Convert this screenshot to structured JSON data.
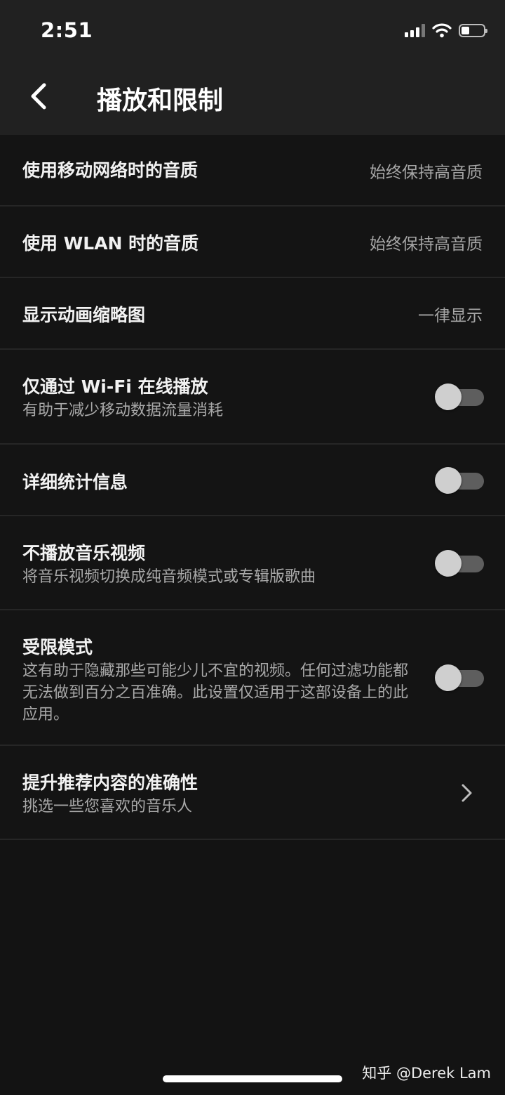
{
  "status_bar": {
    "time": "2:51"
  },
  "header": {
    "title": "播放和限制"
  },
  "settings": [
    {
      "title": "使用移动网络时的音质",
      "value": "始终保持高音质"
    },
    {
      "title": "使用 WLAN 时的音质",
      "value": "始终保持高音质"
    },
    {
      "title": "显示动画缩略图",
      "value": "一律显示"
    },
    {
      "title": "仅通过 Wi-Fi 在线播放",
      "subtitle": "有助于减少移动数据流量消耗",
      "toggle": false
    },
    {
      "title": "详细统计信息",
      "toggle": false
    },
    {
      "title": "不播放音乐视频",
      "subtitle": "将音乐视频切换成纯音频模式或专辑版歌曲",
      "toggle": false
    },
    {
      "title": "受限模式",
      "subtitle": "这有助于隐藏那些可能少儿不宜的视频。任何过滤功能都无法做到百分之百准确。此设置仅适用于这部设备上的此应用。",
      "toggle": false
    },
    {
      "title": "提升推荐内容的准确性",
      "subtitle": "挑选一些您喜欢的音乐人"
    }
  ],
  "watermark": "知乎 @Derek Lam",
  "icons": {
    "back": "back-arrow-icon",
    "chevron": "chevron-right-icon",
    "signal": "signal-icon",
    "wifi": "wifi-icon",
    "battery": "battery-icon"
  },
  "colors": {
    "header_bg": "#212121",
    "list_bg": "#141414",
    "divider": "#262626",
    "toggle_thumb": "#cfcfcf",
    "toggle_track": "#5e5e5e"
  }
}
